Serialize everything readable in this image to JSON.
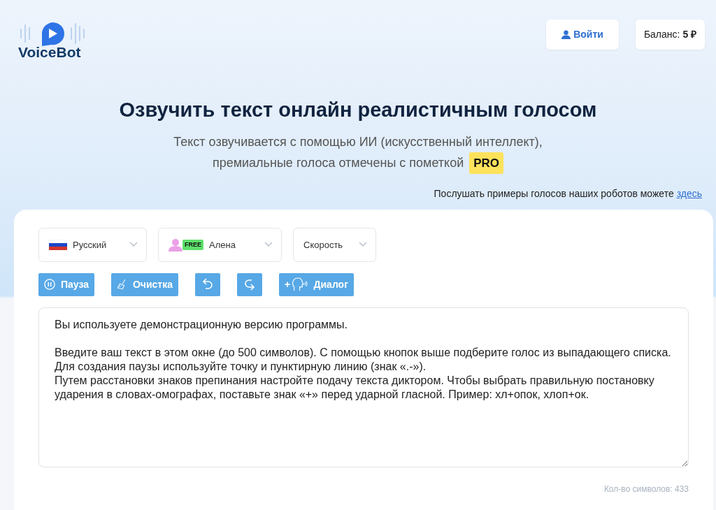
{
  "logo": {
    "text": "VoiceBot"
  },
  "header": {
    "login": "Войти",
    "balance_label": "Баланс:",
    "balance_value": "5 ₽"
  },
  "hero": {
    "title": "Озвучить текст онлайн реалистичным голосом",
    "subtitle_line1": "Текст озвучивается с помощью ИИ (искусственный интеллект),",
    "subtitle_line2": "премиальные голоса отмечены с пометкой",
    "pro_badge": "PRO"
  },
  "samples_note": {
    "text": "Послушать примеры голосов наших роботов можете",
    "link": "здесь"
  },
  "selects": [
    {
      "kind": "language",
      "label": "Русский"
    },
    {
      "kind": "voice",
      "badge": "FREE",
      "label": "Алена"
    },
    {
      "kind": "speed",
      "label": "Скорость"
    }
  ],
  "toolbar": [
    {
      "kind": "pause",
      "label": "Пауза"
    },
    {
      "kind": "clear",
      "label": "Очистка"
    },
    {
      "kind": "undo"
    },
    {
      "kind": "redo"
    },
    {
      "kind": "dialog",
      "prefix": "+",
      "label": "Диалог"
    }
  ],
  "editor": {
    "value": "Вы используете демонстрационную версию программы.\n\nВведите ваш текст в этом окне (до 500 символов). С помощью кнопок выше подберите голос из выпадающего списка. Для создания паузы используйте точку и пунктирную линию (знак «.-»).\nПутем расстановки знаков препинания настройте подачу текста диктором. Чтобы выбрать правильную постановку ударения в словах-омографах, поставьте знак «+» перед ударной гласной. Пример: хл+опок, хлоп+ок.",
    "counter": "Кол-во символов: 433"
  }
}
